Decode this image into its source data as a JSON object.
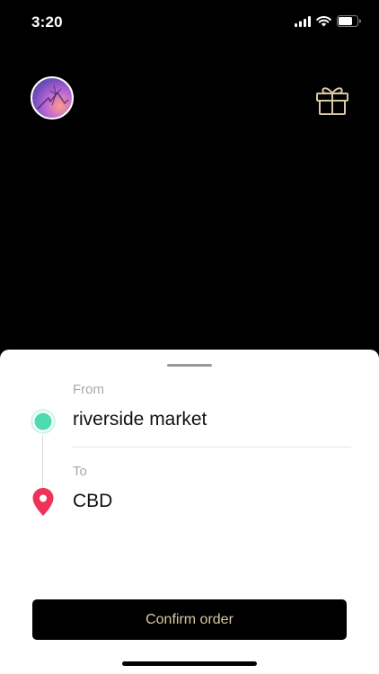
{
  "status_bar": {
    "time": "3:20"
  },
  "colors": {
    "gift_accent": "#d9c8a0",
    "origin": "#4ddbb0",
    "destination": "#f0325a",
    "confirm_text": "#d9c8a0"
  },
  "route": {
    "from_label": "From",
    "from_value": "riverside market",
    "to_label": "To",
    "to_value": "CBD"
  },
  "confirm_label": "Confirm order",
  "icons": [
    "signal-icon",
    "wifi-icon",
    "battery-icon",
    "gift-icon",
    "origin-dot-icon",
    "location-pin-icon"
  ]
}
